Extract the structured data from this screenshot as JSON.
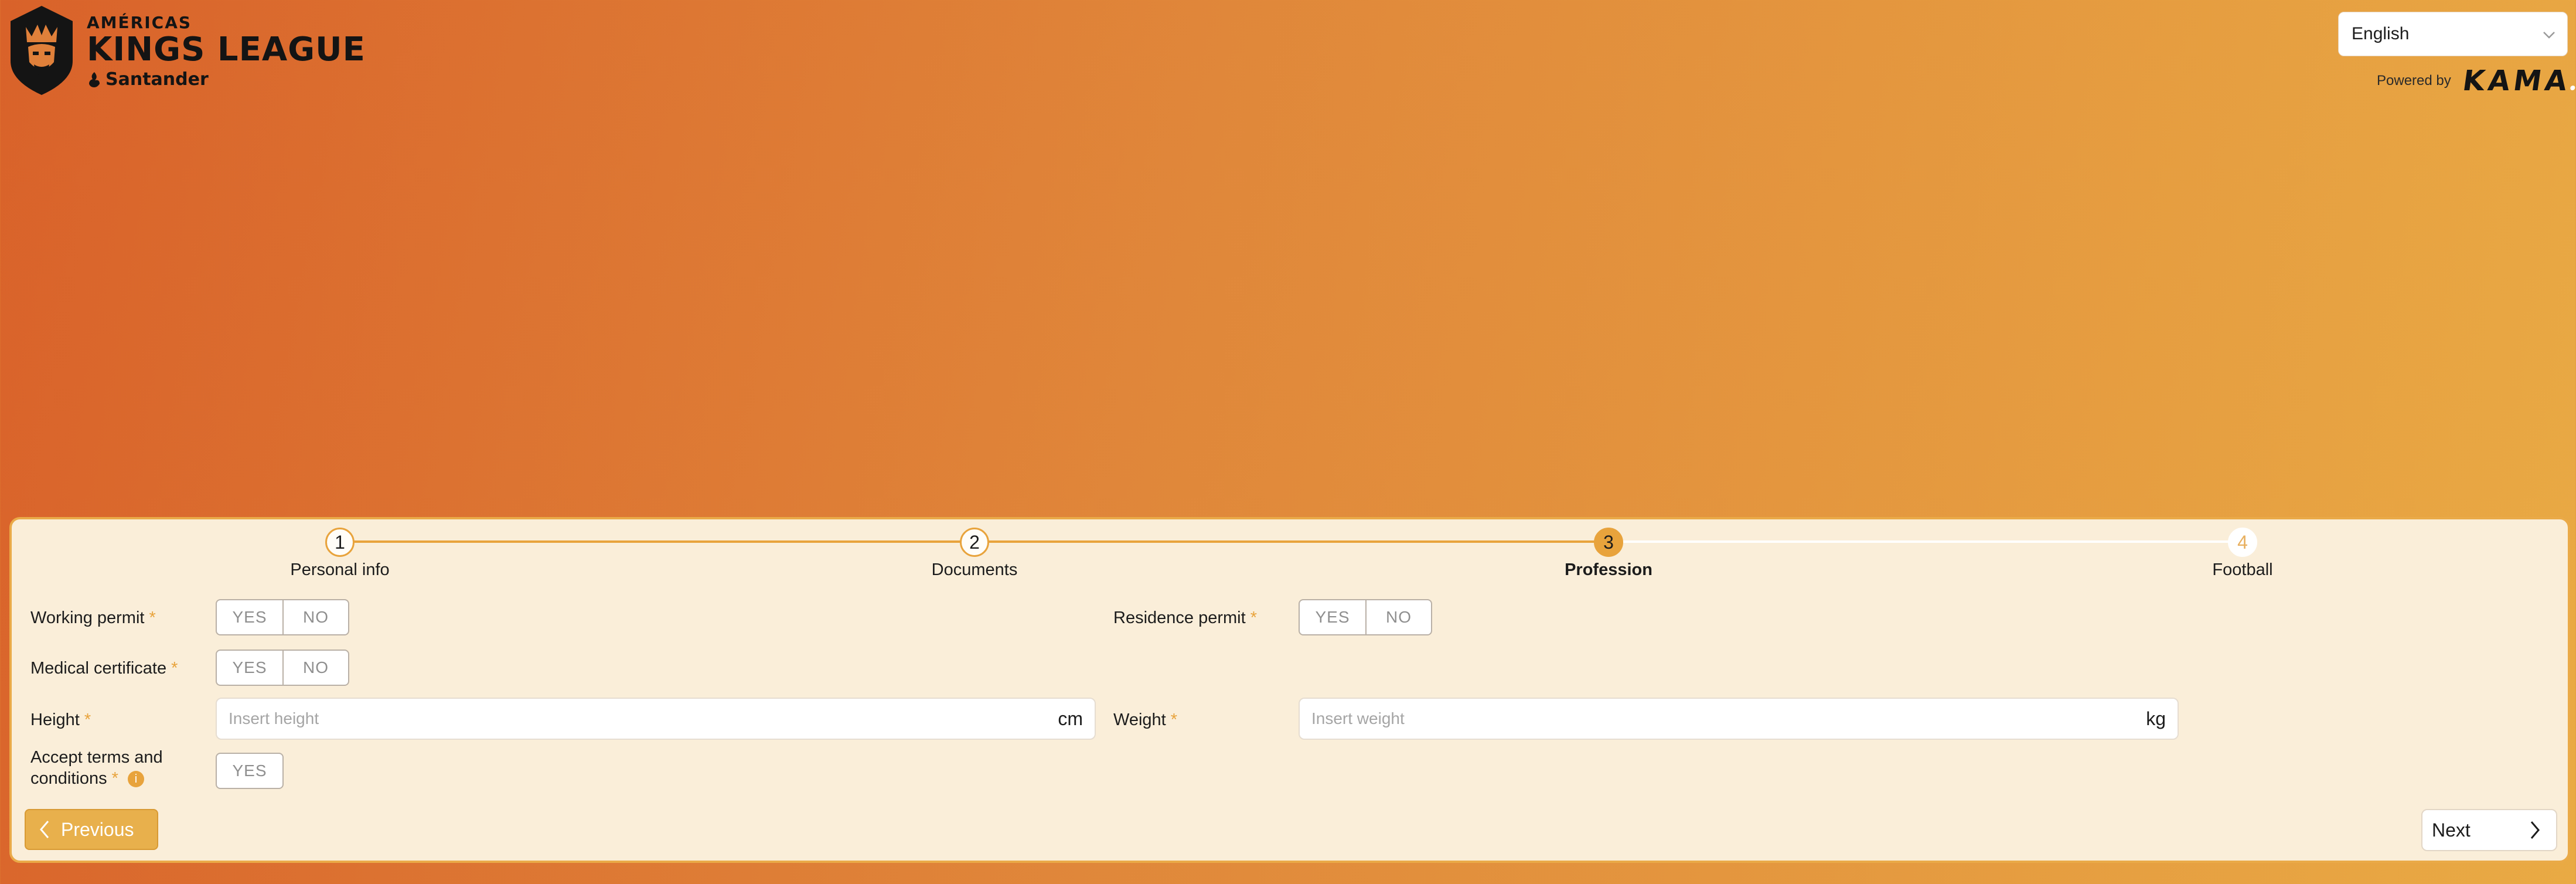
{
  "brand": {
    "line1": "AMÉRICAS",
    "line2": "KINGS LEAGUE",
    "sponsor": "Santander",
    "colors": {
      "accent": "#e8a33c",
      "card": "#faeed9"
    }
  },
  "language": {
    "selected": "English"
  },
  "powered_by": {
    "label": "Powered by",
    "brand": "KAMA"
  },
  "stepper": {
    "steps": [
      {
        "number": "1",
        "label": "Personal info",
        "state": "completed"
      },
      {
        "number": "2",
        "label": "Documents",
        "state": "completed"
      },
      {
        "number": "3",
        "label": "Profession",
        "state": "active"
      },
      {
        "number": "4",
        "label": "Football",
        "state": "upcoming"
      }
    ]
  },
  "form": {
    "working_permit": {
      "label": "Working permit",
      "required": "*",
      "yes": "YES",
      "no": "NO"
    },
    "residence_permit": {
      "label": "Residence permit",
      "required": "*",
      "yes": "YES",
      "no": "NO"
    },
    "medical_certificate": {
      "label": "Medical certificate",
      "required": "*",
      "yes": "YES",
      "no": "NO"
    },
    "height": {
      "label": "Height",
      "required": "*",
      "placeholder": "Insert height",
      "unit": "cm"
    },
    "weight": {
      "label": "Weight",
      "required": "*",
      "placeholder": "Insert weight",
      "unit": "kg"
    },
    "terms": {
      "label_line1": "Accept terms and",
      "label_line2": "conditions",
      "required": "*",
      "info": "i",
      "yes": "YES"
    }
  },
  "nav": {
    "previous": "Previous",
    "next": "Next"
  }
}
